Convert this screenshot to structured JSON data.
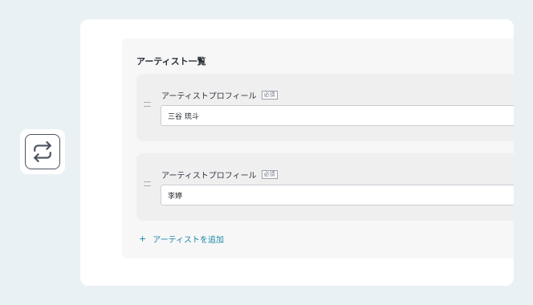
{
  "repeat_icon": "repeat-icon",
  "artists": {
    "section_title": "アーティスト一覧",
    "items": [
      {
        "label": "アーティストプロフィール",
        "badge": "必須",
        "value": "三谷 琉斗"
      },
      {
        "label": "アーティストプロフィール",
        "badge": "必須",
        "value": "李婷"
      }
    ],
    "add_label": "アーティストを追加",
    "add_icon": "plus-icon",
    "drag_icon": "drag-handle-icon"
  },
  "colors": {
    "background": "#e9f1f4",
    "accent": "#1b87a8",
    "text": "#2a2f37"
  }
}
